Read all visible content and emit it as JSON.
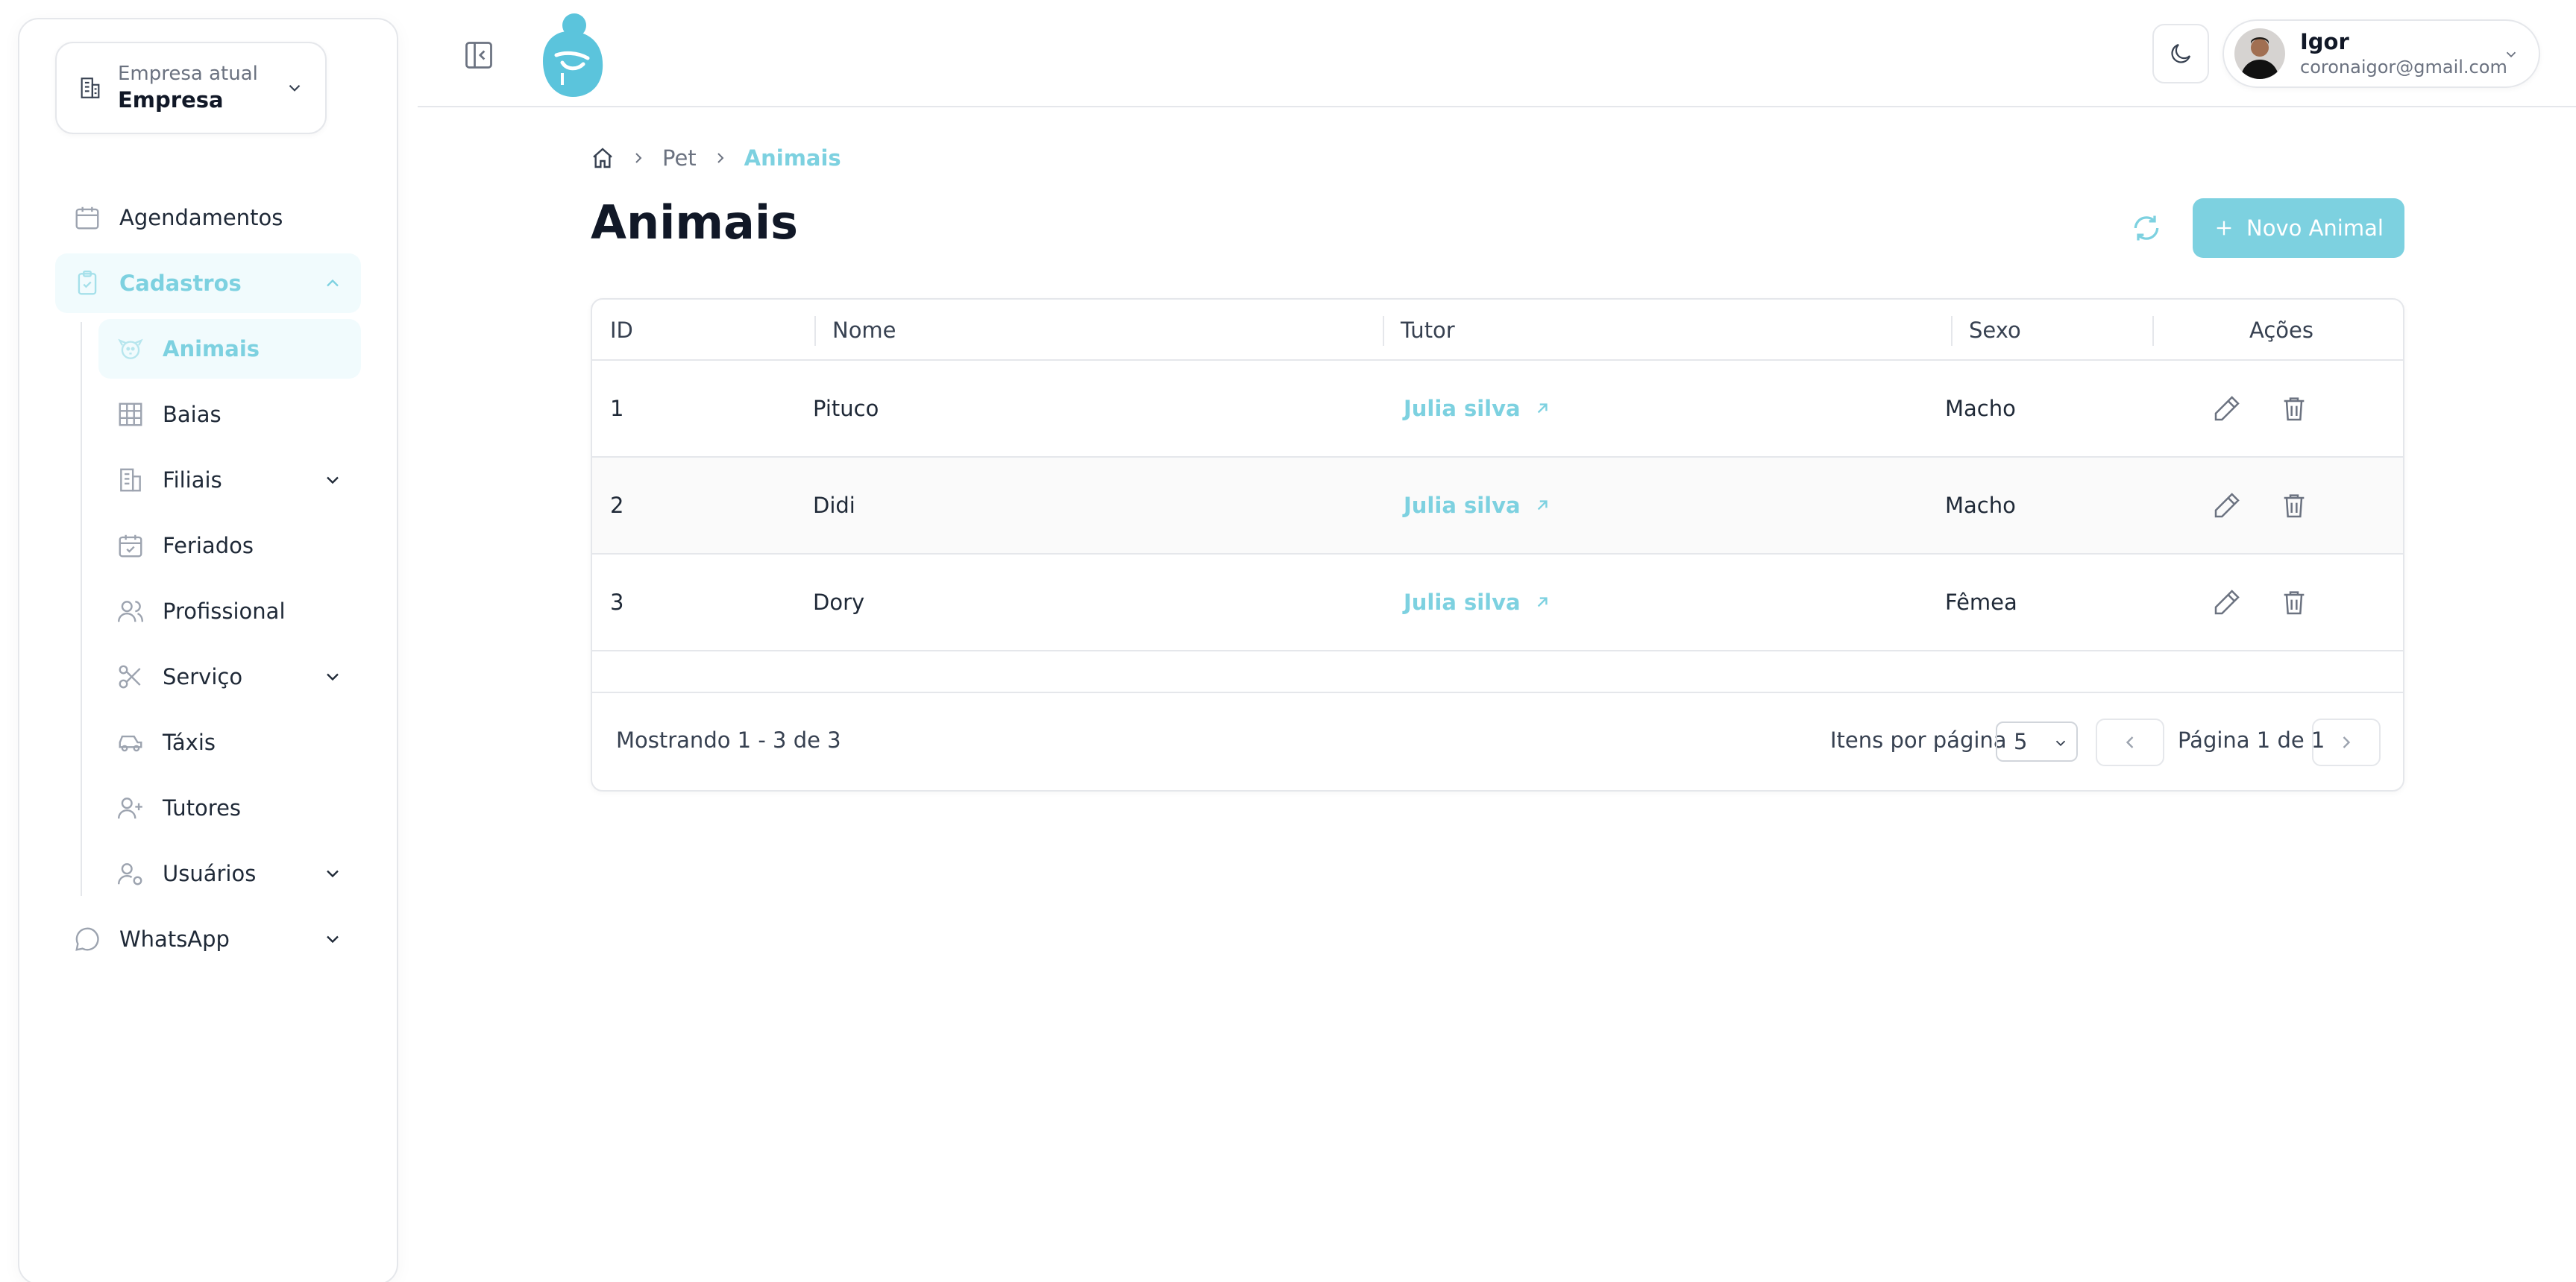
{
  "company": {
    "label": "Empresa atual",
    "name": "Empresa"
  },
  "sidebar": {
    "items": [
      {
        "label": "Agendamentos",
        "icon": "calendar-icon"
      },
      {
        "label": "Cadastros",
        "icon": "clipboard-check-icon",
        "expanded": true
      },
      {
        "label": "WhatsApp",
        "icon": "chat-bubble-icon"
      }
    ],
    "cadastros_items": [
      {
        "label": "Animais",
        "icon": "dog-face-icon",
        "active": true
      },
      {
        "label": "Baias",
        "icon": "grid-icon"
      },
      {
        "label": "Filiais",
        "icon": "building-icon"
      },
      {
        "label": "Feriados",
        "icon": "calendar-check-icon"
      },
      {
        "label": "Profissional",
        "icon": "users-icon"
      },
      {
        "label": "Serviço",
        "icon": "scissors-icon"
      },
      {
        "label": "Táxis",
        "icon": "car-icon"
      },
      {
        "label": "Tutores",
        "icon": "user-plus-icon"
      },
      {
        "label": "Usuários",
        "icon": "user-gear-icon"
      }
    ]
  },
  "user": {
    "name": "Igor",
    "email": "coronaigor@gmail.com"
  },
  "breadcrumb": [
    "Pet",
    "Animais"
  ],
  "page": {
    "title": "Animais",
    "new_button": "Novo Animal"
  },
  "table": {
    "columns": [
      "ID",
      "Nome",
      "Tutor",
      "Sexo",
      "Ações"
    ],
    "rows": [
      {
        "id": "1",
        "nome": "Pituco",
        "tutor": "Julia silva",
        "sexo": "Macho"
      },
      {
        "id": "2",
        "nome": "Didi",
        "tutor": "Julia silva",
        "sexo": "Macho"
      },
      {
        "id": "3",
        "nome": "Dory",
        "tutor": "Julia silva",
        "sexo": "Fêmea"
      }
    ]
  },
  "pagination": {
    "showing": "Mostrando 1 - 3 de 3",
    "per_page_label": "Itens por página",
    "per_page_value": "5",
    "page_text": "Página 1 de 1"
  },
  "colors": {
    "accent": "#7dd1e0",
    "accent_light": "#f1fbfd",
    "border": "#e5e7eb"
  }
}
